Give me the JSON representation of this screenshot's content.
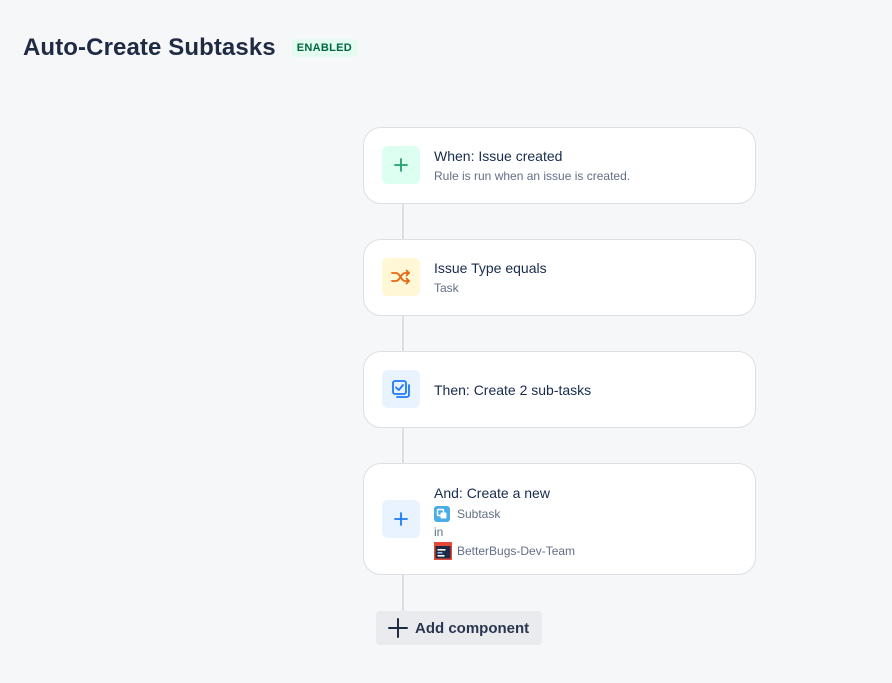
{
  "header": {
    "title": "Auto-Create Subtasks",
    "status_badge": "ENABLED"
  },
  "steps": [
    {
      "icon": "plus-icon",
      "title": "When: Issue created",
      "subtitle": "Rule is run when an issue is created."
    },
    {
      "icon": "shuffle-icon",
      "title": "Issue Type equals",
      "subtitle": "Task"
    },
    {
      "icon": "checkbox-stack-icon",
      "title": "Then: Create 2 sub-tasks"
    },
    {
      "icon": "plus-icon",
      "title": "And: Create a new",
      "issue_type": "Subtask",
      "in_label": "in",
      "project": "BetterBugs-Dev-Team"
    }
  ],
  "add_component_label": "Add component",
  "colors": {
    "trigger_green": "#22a06b",
    "condition_orange": "#e56910",
    "action_blue": "#1d7afc",
    "badge_text": "#006644",
    "badge_bg": "#e3fcef"
  }
}
